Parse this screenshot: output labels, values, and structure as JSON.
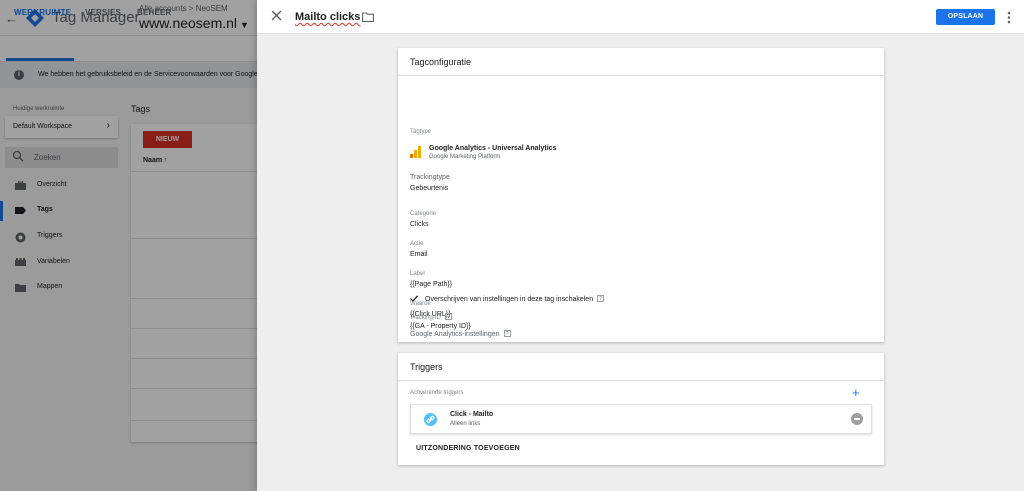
{
  "app": {
    "title": "Tag Manager",
    "breadcrumb": "Alle accounts > NeoSEM",
    "container": "www.neosem.nl"
  },
  "tabs": [
    {
      "label": "WERKRUIMTE",
      "active": true
    },
    {
      "label": "VERSIES",
      "active": false
    },
    {
      "label": "BEHEER",
      "active": false
    }
  ],
  "notice": "We hebben het gebruiksbeleid en de Servicevoorwaarden voor Google T",
  "sidebar": {
    "workspace_label": "Huidige werkruimte",
    "workspace_name": "Default Workspace",
    "search_placeholder": "Zoeken",
    "items": [
      {
        "label": "Overzicht",
        "icon": "briefcase-icon",
        "active": false
      },
      {
        "label": "Tags",
        "icon": "tag-icon",
        "active": true
      },
      {
        "label": "Triggers",
        "icon": "trigger-icon",
        "active": false
      },
      {
        "label": "Variabelen",
        "icon": "variables-icon",
        "active": false
      },
      {
        "label": "Mappen",
        "icon": "folder-icon",
        "active": false
      }
    ]
  },
  "tags_list": {
    "title": "Tags",
    "new_button": "NIEUW",
    "column_name": "Naam ↑"
  },
  "panel": {
    "title": "Mailto clicks",
    "save_button": "OPSLAAN"
  },
  "tag_config": {
    "title": "Tagconfiguratie",
    "tagtype_label": "Tagtype",
    "tagtype_name": "Google Analytics - Universal Analytics",
    "tagtype_sub": "Google Marketing Platform",
    "tracking_type_label": "Trackingtype",
    "tracking_type_value": "Gebeurtenis",
    "category_label": "Categorie",
    "category_value": "Clicks",
    "action_label": "Actie",
    "action_value": "Email",
    "label_label": "Label",
    "label_value": "{{Page Path}}",
    "value_label": "Waarde",
    "value_value": "{{Click URL}}",
    "ga_settings_label": "Google Analytics-instellingen",
    "override_text": "Overschrijven van instellingen in deze tag inschakelen",
    "tracking_id_label": "Tracking-ID",
    "tracking_id_value": "{{GA - Property ID}}",
    "help_glyph": "?"
  },
  "triggers": {
    "title": "Triggers",
    "firing_label": "Activerende triggers",
    "trigger_name": "Click - Mailto",
    "trigger_sub": "Alleen links",
    "exception_button": "UITZONDERING TOEVOEGEN"
  },
  "colors": {
    "accent": "#1a73e8",
    "new_button": "#d93025",
    "ga_orange": "#f9ab00",
    "ga_dark_orange": "#e37400",
    "trigger_blue": "#4fc3f7"
  }
}
